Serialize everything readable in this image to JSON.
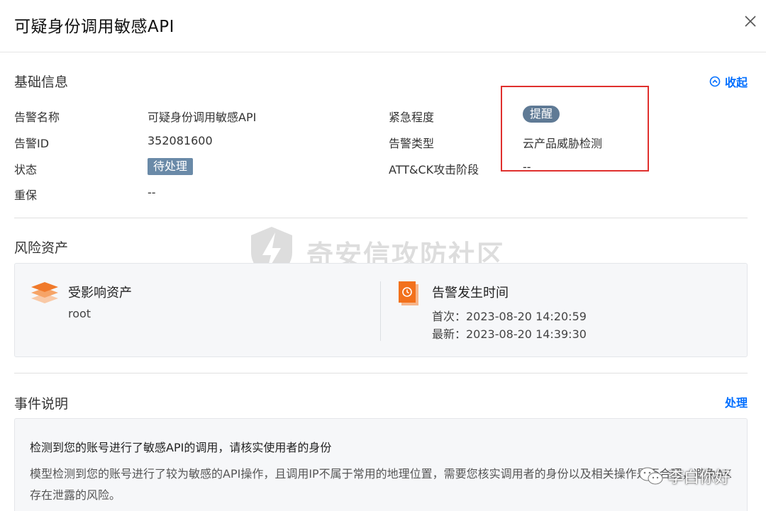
{
  "dialog": {
    "title": "可疑身份调用敏感API"
  },
  "basic": {
    "section_title": "基础信息",
    "collapse_label": "收起",
    "fields": {
      "alert_name_label": "告警名称",
      "alert_name_value": "可疑身份调用敏感API",
      "alert_id_label": "告警ID",
      "alert_id_value": "352081600",
      "status_label": "状态",
      "status_value": "待处理",
      "insured_label": "重保",
      "insured_value": "--",
      "urgency_label": "紧急程度",
      "urgency_value": "提醒",
      "alert_type_label": "告警类型",
      "alert_type_value": "云产品威胁检测",
      "attck_label": "ATT&CK攻击阶段",
      "attck_value": "--"
    }
  },
  "risk": {
    "section_title": "风险资产",
    "asset_title": "受影响资产",
    "asset_value": "root",
    "time_title": "告警发生时间",
    "first_time": "首次：2023-08-20 14:20:59",
    "latest_time": "最新：2023-08-20 14:39:30"
  },
  "event": {
    "section_title": "事件说明",
    "action_label": "处理",
    "headline": "检测到您的账号进行了敏感API的调用，请核实使用者的身份",
    "body": "模型检测到您的账号进行了较为敏感的API操作，且调用IP不属于常用的地理位置，需要您核实调用者的身份以及相关操作是否合理，避免AK存在泄露的风险。"
  },
  "watermark": {
    "text": "奇安信攻防社区",
    "wechat": "李白你好"
  },
  "colors": {
    "accent": "#006eff",
    "highlight_box": "#e0302d",
    "tag_bg": "#5f7a95"
  }
}
